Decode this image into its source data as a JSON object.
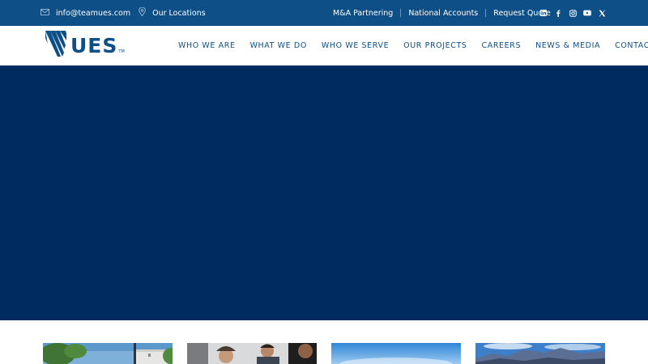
{
  "topbar": {
    "email": "info@teamues.com",
    "locations": "Our Locations",
    "links": [
      "M&A Partnering",
      "National Accounts",
      "Request Quote"
    ],
    "social_icons": [
      "linkedin-icon",
      "facebook-icon",
      "instagram-icon",
      "youtube-icon",
      "x-icon"
    ],
    "background": "#0d4f86"
  },
  "header": {
    "logo_text": "UES",
    "logo_tm": "TM",
    "nav": [
      "WHO WE ARE",
      "WHAT WE DO",
      "WHO WE SERVE",
      "OUR PROJECTS",
      "CAREERS",
      "NEWS & MEDIA",
      "CONTACT"
    ],
    "brand_color": "#0d4f86"
  },
  "hero": {
    "background": "#002b60"
  },
  "cards": [
    "building-photo",
    "people-photo",
    "sky-photo",
    "mountain-photo"
  ]
}
